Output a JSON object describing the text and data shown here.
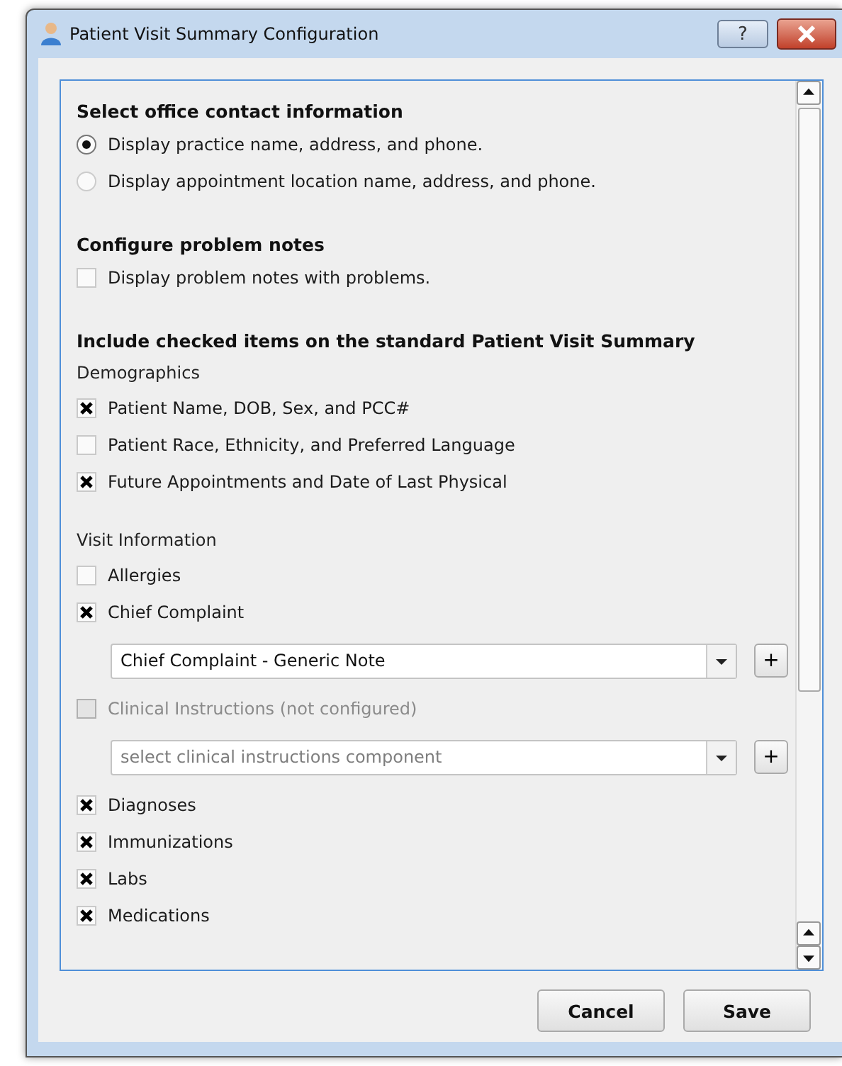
{
  "window": {
    "title": "Patient Visit Summary Configuration"
  },
  "items": [
    {
      "kind": "heading",
      "text": "Select office contact information"
    },
    {
      "kind": "radio",
      "text": "Display practice name, address, and phone.",
      "selected": true
    },
    {
      "kind": "radio",
      "text": "Display appointment location name, address, and phone.",
      "selected": false
    },
    {
      "kind": "heading",
      "text": "Configure problem notes"
    },
    {
      "kind": "checkbox",
      "text": "Display problem notes with problems.",
      "checked": false,
      "disabled": false
    },
    {
      "kind": "heading",
      "text": "Include checked items on the standard Patient Visit Summary"
    },
    {
      "kind": "label",
      "text": "Demographics"
    },
    {
      "kind": "checkbox",
      "text": "Patient Name, DOB, Sex, and PCC#",
      "checked": true,
      "disabled": false
    },
    {
      "kind": "checkbox",
      "text": "Patient Race, Ethnicity, and Preferred Language",
      "checked": false,
      "disabled": false
    },
    {
      "kind": "checkbox",
      "text": "Future Appointments and Date of Last Physical",
      "checked": true,
      "disabled": false
    },
    {
      "kind": "label",
      "text": "Visit Information"
    },
    {
      "kind": "checkbox",
      "text": "Allergies",
      "checked": false,
      "disabled": false
    },
    {
      "kind": "checkbox",
      "text": "Chief Complaint",
      "checked": true,
      "disabled": false
    },
    {
      "kind": "select",
      "value": "Chief Complaint - Generic Note",
      "add": "+"
    },
    {
      "kind": "checkbox",
      "text": "Clinical Instructions (not configured)",
      "checked": false,
      "disabled": true
    },
    {
      "kind": "select",
      "placeholder": "select clinical instructions component",
      "add": "+"
    },
    {
      "kind": "checkbox",
      "text": "Diagnoses",
      "checked": true,
      "disabled": false
    },
    {
      "kind": "checkbox",
      "text": "Immunizations",
      "checked": true,
      "disabled": false
    },
    {
      "kind": "checkbox",
      "text": "Labs",
      "checked": true,
      "disabled": false
    },
    {
      "kind": "checkbox",
      "text": "Medications",
      "checked": true,
      "disabled": false
    }
  ],
  "buttons": [
    "Cancel",
    "Save"
  ],
  "help_button": "?"
}
